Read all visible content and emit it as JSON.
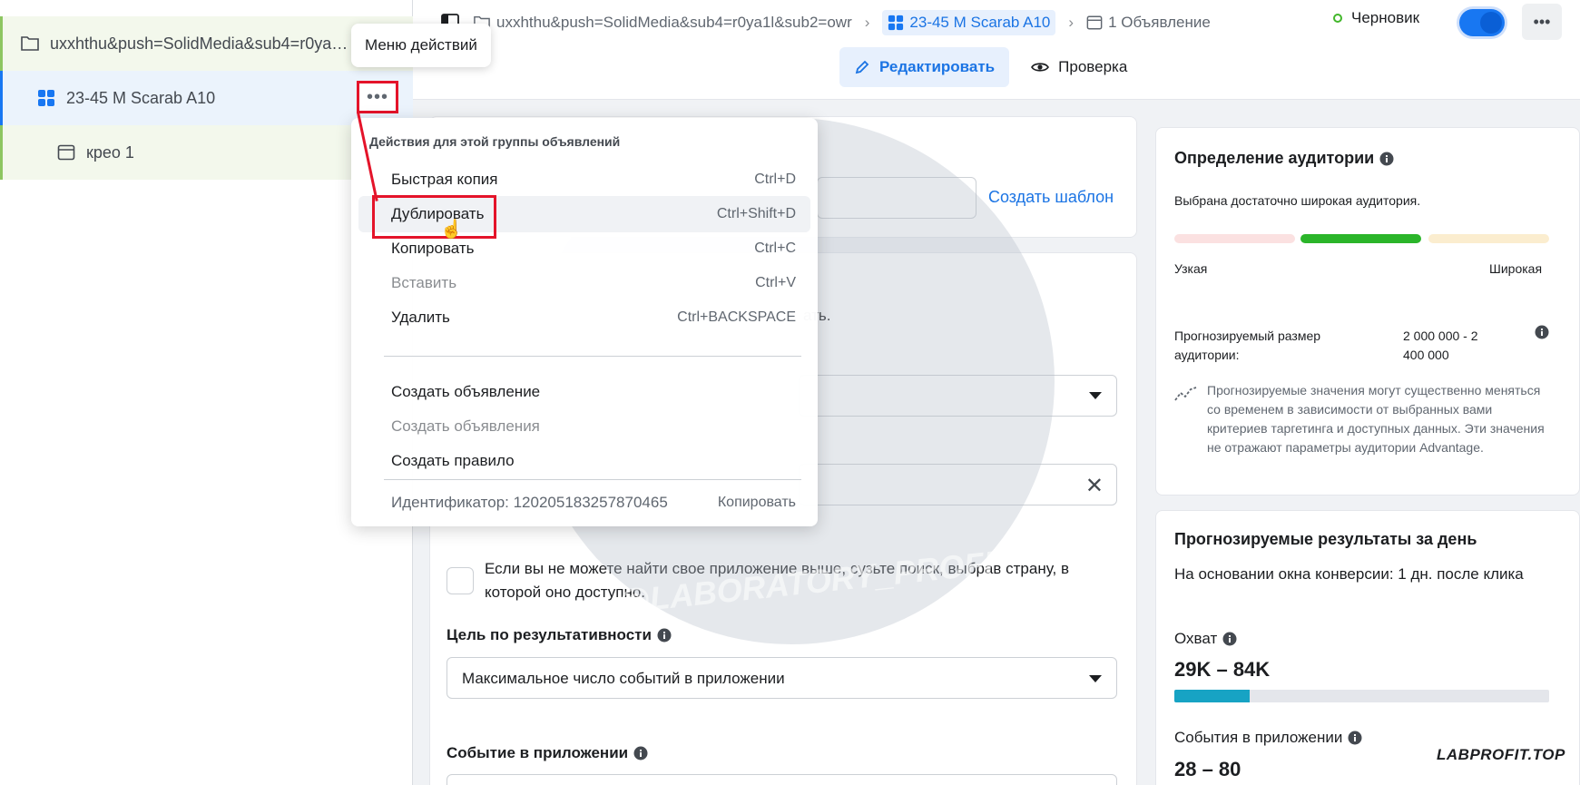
{
  "sidebar": {
    "campaign_label": "uxxhthu&push=SolidMedia&sub4=r0ya…",
    "adset_label": "23-45 M Scarab A10",
    "ad_label": "крео 1",
    "more_icon": "•••"
  },
  "topbar": {
    "crumb_campaign": "uxxhthu&push=SolidMedia&sub4=r0ya1l&sub2=owr",
    "crumb_adset": "23-45 M Scarab A10",
    "crumb_ad": "1 Объявление",
    "status": "Черновик",
    "toggle_on": true,
    "more_icon": "•••",
    "tab_edit": "Редактировать",
    "tab_review": "Проверка"
  },
  "tooltip": {
    "text": "Меню действий"
  },
  "menu": {
    "header": "Действия для этой группы объявлений",
    "items": [
      {
        "label": "Быстрая копия",
        "shortcut": "Ctrl+D",
        "enabled": true
      },
      {
        "label": "Дублировать",
        "shortcut": "Ctrl+Shift+D",
        "enabled": true
      },
      {
        "label": "Копировать",
        "shortcut": "Ctrl+C",
        "enabled": true
      },
      {
        "label": "Вставить",
        "shortcut": "Ctrl+V",
        "enabled": false
      },
      {
        "label": "Удалить",
        "shortcut": "Ctrl+BACKSPACE",
        "enabled": true
      },
      {
        "label": "Создать объявление",
        "shortcut": "",
        "enabled": true
      },
      {
        "label": "Создать объявления",
        "shortcut": "",
        "enabled": false
      },
      {
        "label": "Создать правило",
        "shortcut": "",
        "enabled": true
      }
    ],
    "id_label": "Идентификатор: 120205183257870465",
    "id_copy": "Копировать"
  },
  "main": {
    "create_template": "Создать шаблон",
    "partial_text": "ать.",
    "checkbox_text": "Если вы не можете найти свое приложение выше, сузьте поиск, выбрав страну, в которой оно доступно.",
    "goal_label": "Цель по результативности",
    "goal_value": "Максимальное число событий в приложении",
    "event_label": "Событие в приложении"
  },
  "audience": {
    "title": "Определение аудитории",
    "subtitle": "Выбрана достаточно широкая аудитория.",
    "narrow": "Узкая",
    "wide": "Широкая",
    "size_label": "Прогнозируемый размер аудитории:",
    "size_value": "2 000 000 - 2 400 000",
    "note": "Прогнозируемые значения могут существенно меняться со временем в зависимости от выбранных вами критериев таргетинга и доступных данных. Эти значения не отражают параметры аудитории Advantage."
  },
  "results": {
    "title": "Прогнозируемые результаты за день",
    "subtitle": "На основании окна конверсии: 1 дн. после клика",
    "reach_label": "Охват",
    "reach_value": "29K – 84K",
    "reach_fill": 0.2,
    "events_label": "События в приложении",
    "events_value": "28 – 80"
  },
  "watermark": {
    "overlay_text": "@LABORATORY_PROFIT",
    "brand": "LABPROFIT.TOP"
  },
  "colors": {
    "accent": "#1877f2",
    "highlight_red": "#e4142a",
    "meter_good": "#2bb52a",
    "reach_bar": "#17a3c4"
  }
}
